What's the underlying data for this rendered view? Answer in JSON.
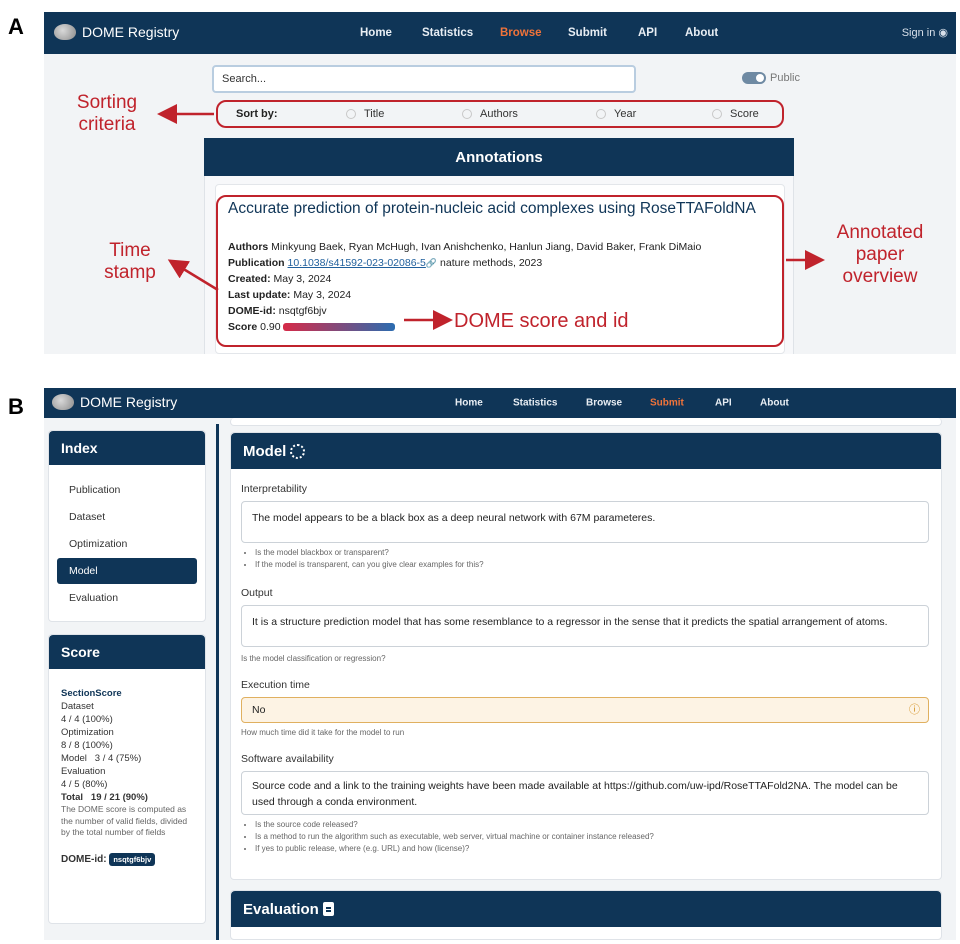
{
  "panel_labels": {
    "a": "A",
    "b": "B"
  },
  "app": {
    "name": "DOME Registry"
  },
  "panelA": {
    "nav": {
      "items": [
        "Home",
        "Statistics",
        "Browse",
        "Submit",
        "API",
        "About"
      ],
      "active": "Browse",
      "sign_in": "Sign in"
    },
    "search": {
      "placeholder": "Search..."
    },
    "public_toggle": {
      "label": "Public",
      "on": true
    },
    "sort": {
      "label": "Sort by:",
      "options": [
        "Title",
        "Authors",
        "Year",
        "Score"
      ]
    },
    "annotations_header": "Annotations",
    "paper": {
      "title": "Accurate prediction of protein-nucleic acid complexes using RoseTTAFoldNA",
      "authors_label": "Authors",
      "authors": "Minkyung Baek, Ryan McHugh, Ivan Anishchenko, Hanlun Jiang, David Baker, Frank DiMaio",
      "publication_label": "Publication",
      "doi": "10.1038/s41592-023-02086-5",
      "journal": "nature methods, 2023",
      "created_label": "Created:",
      "created": "May 3, 2024",
      "updated_label": "Last update:",
      "updated": "May 3, 2024",
      "dome_id_label": "DOME-id:",
      "dome_id": "nsqtgf6bjv",
      "score_label": "Score",
      "score": "0.90",
      "score_value": 0.9
    },
    "callouts": {
      "sorting": "Sorting criteria",
      "timestamp": "Time stamp",
      "dome_score": "DOME score and id",
      "overview": "Annotated paper overview"
    }
  },
  "panelB": {
    "nav": {
      "items": [
        "Home",
        "Statistics",
        "Browse",
        "Submit",
        "API",
        "About"
      ],
      "active": "Submit"
    },
    "index": {
      "title": "Index",
      "items": [
        "Publication",
        "Dataset",
        "Optimization",
        "Model",
        "Evaluation"
      ],
      "active": "Model"
    },
    "score": {
      "title": "Score",
      "section_score": "SectionScore",
      "rows": [
        "Dataset",
        "4 / 4 (100%)",
        "Optimization",
        "8 / 8 (100%)",
        "Model   3 / 4 (75%)",
        "Evaluation",
        "4 / 5 (80%)"
      ],
      "total_label": "Total",
      "total": "19 / 21 (90%)",
      "note": "The DOME score is computed as the number of valid fields, divided by the total number of fields",
      "dome_id_label": "DOME-id:",
      "dome_id": "nsqtgf6bjv"
    },
    "model": {
      "title": "Model",
      "fields": {
        "interpretability": {
          "label": "Interpretability",
          "value": "The model appears to be a black box as a deep neural network with 67M parameteres.",
          "hints": [
            "Is the model blackbox or transparent?",
            "If the model is transparent, can you give clear examples for this?"
          ]
        },
        "output": {
          "label": "Output",
          "value": "It is a structure prediction model that has some resemblance to a regressor in the sense that it predicts the spatial arrangement of atoms.",
          "hint": "Is the model classification or regression?"
        },
        "execution_time": {
          "label": "Execution time",
          "value": "No",
          "hint": "How much time did it take for the model to run"
        },
        "software": {
          "label": "Software availability",
          "value": "Source code and a link to the training weights have been made available at https://github.com/uw-ipd/RoseTTAFold2NA. The model can be used through a conda environment.",
          "hints": [
            "Is the source code released?",
            "Is a method to run the algorithm such as executable, web server, virtual machine or container instance released?",
            "If yes to public release, where (e.g. URL) and how (license)?"
          ]
        }
      }
    },
    "evaluation": {
      "title": "Evaluation"
    }
  },
  "colors": {
    "navy": "#0f3557",
    "accent_orange": "#f0733a",
    "annotation_red": "#c0232c"
  }
}
